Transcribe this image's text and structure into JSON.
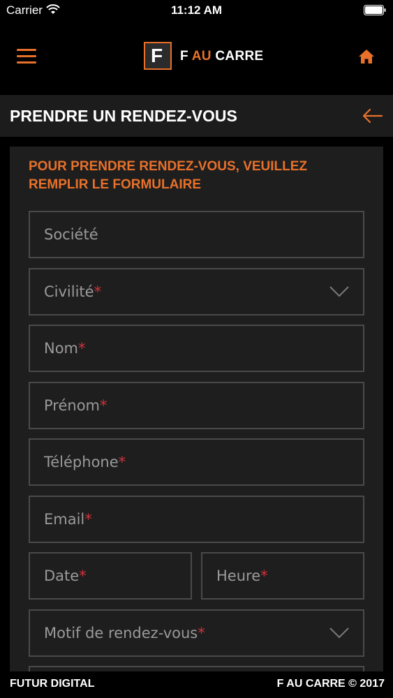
{
  "status_bar": {
    "carrier": "Carrier",
    "time": "11:12 AM"
  },
  "header": {
    "brand_prefix": "F ",
    "brand_accent": "AU",
    "brand_suffix": " CARRE",
    "logo_letter": "F"
  },
  "title_bar": {
    "title": "PRENDRE UN RENDEZ-VOUS"
  },
  "form": {
    "heading": "POUR PRENDRE RENDEZ-VOUS, VEUILLEZ REMPLIR LE FORMULAIRE",
    "fields": [
      {
        "label": "Société",
        "required": ""
      },
      {
        "label": "Civilité",
        "required": "*"
      },
      {
        "label": "Nom",
        "required": "*"
      },
      {
        "label": "Prénom",
        "required": "*"
      },
      {
        "label": "Téléphone",
        "required": "*"
      },
      {
        "label": "Email",
        "required": "*"
      },
      {
        "label": "Date",
        "required": "*"
      },
      {
        "label": "Heure",
        "required": "*"
      },
      {
        "label": "Motif de rendez-vous",
        "required": "*"
      }
    ]
  },
  "footer": {
    "left": "FUTUR DIGITAL",
    "right": "F AU CARRE © 2017"
  },
  "colors": {
    "accent": "#e8712a",
    "required": "#d0333a",
    "panel": "#1e1e1e",
    "border": "#4a4a4a"
  }
}
